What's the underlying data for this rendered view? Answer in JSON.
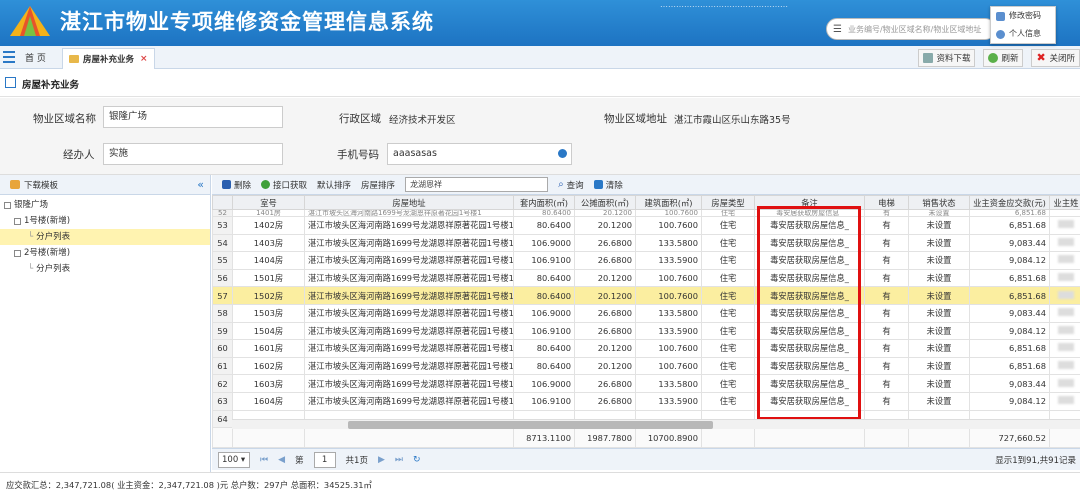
{
  "app": {
    "title": "湛江市物业专项维修资金管理信息系统",
    "top_right_text": "…………………………………………",
    "search_placeholder": "业务编号/物业区域名称/物业区域地址",
    "user_menu": [
      "修改密码",
      "个人信息"
    ],
    "colors": {
      "header": "#1d73c2",
      "selected_row": "#fbeea0",
      "tree_selected": "#fff3b0",
      "highlight": "#e01010"
    }
  },
  "menu_bar": {
    "home_tab": "首 页",
    "active_tab": "房屋补充业务",
    "close_icon": "×",
    "right_buttons": [
      "资料下载",
      "刷新",
      "关闭所"
    ]
  },
  "page_title": "房屋补充业务",
  "form": {
    "region_label": "物业区域名称",
    "region_value": "银隆广场",
    "district_label": "行政区域",
    "district_value": "经济技术开发区",
    "address_label": "物业区域地址",
    "address_value": "湛江市霞山区乐山东路35号",
    "handler_label": "经办人",
    "handler_value": "实施",
    "phone_label": "手机号码",
    "phone_value": "aaasasas"
  },
  "sidebar": {
    "header": "下载模板",
    "collapse_icon": "«",
    "tree": [
      {
        "label": "银隆广场",
        "level": 0,
        "selected": false
      },
      {
        "label": "1号楼(新增)",
        "level": 1,
        "selected": false
      },
      {
        "label": "分户列表",
        "level": 2,
        "selected": true
      },
      {
        "label": "2号楼(新增)",
        "level": 1,
        "selected": false
      },
      {
        "label": "分户列表",
        "level": 2,
        "selected": false
      }
    ]
  },
  "grid_toolbar": {
    "delete": "删除",
    "api_fetch": "接口获取",
    "default_sort": "默认排序",
    "house_sort": "房屋排序",
    "search_value": "龙湖恩祥",
    "query": "查询",
    "clear": "清除"
  },
  "table": {
    "columns": [
      "室号",
      "房屋地址",
      "套内面积(㎡)",
      "公摊面积(㎡)",
      "建筑面积(㎡)",
      "房屋类型",
      "备注",
      "电梯",
      "销售状态",
      "业主资金应交款(元)",
      "业主姓"
    ],
    "cut_row": {
      "num": "52",
      "room": "1401房",
      "address": "湛江市坡头区海河南路1699号龙湖恩祥原著花园1号楼1",
      "inner": "80.6400",
      "shared": "20.1200",
      "built": "100.7600",
      "type": "住宅",
      "note": "毒安居获取房屋信息_",
      "elevator": "有",
      "status": "未设置",
      "amount": "6,851.68"
    },
    "rows": [
      {
        "num": "53",
        "room": "1402房",
        "address": "湛江市坡头区海河南路1699号龙湖恩祥原著花园1号楼1",
        "inner": "80.6400",
        "shared": "20.1200",
        "built": "100.7600",
        "type": "住宅",
        "note": "毒安居获取房屋信息_",
        "elevator": "有",
        "status": "未设置",
        "amount": "6,851.68",
        "selected": false
      },
      {
        "num": "54",
        "room": "1403房",
        "address": "湛江市坡头区海河南路1699号龙湖恩祥原著花园1号楼1",
        "inner": "106.9000",
        "shared": "26.6800",
        "built": "133.5800",
        "type": "住宅",
        "note": "毒安居获取房屋信息_",
        "elevator": "有",
        "status": "未设置",
        "amount": "9,083.44",
        "selected": false
      },
      {
        "num": "55",
        "room": "1404房",
        "address": "湛江市坡头区海河南路1699号龙湖恩祥原著花园1号楼1",
        "inner": "106.9100",
        "shared": "26.6800",
        "built": "133.5900",
        "type": "住宅",
        "note": "毒安居获取房屋信息_",
        "elevator": "有",
        "status": "未设置",
        "amount": "9,084.12",
        "selected": false
      },
      {
        "num": "56",
        "room": "1501房",
        "address": "湛江市坡头区海河南路1699号龙湖恩祥原著花园1号楼1",
        "inner": "80.6400",
        "shared": "20.1200",
        "built": "100.7600",
        "type": "住宅",
        "note": "毒安居获取房屋信息_",
        "elevator": "有",
        "status": "未设置",
        "amount": "6,851.68",
        "selected": false
      },
      {
        "num": "57",
        "room": "1502房",
        "address": "湛江市坡头区海河南路1699号龙湖恩祥原著花园1号楼1",
        "inner": "80.6400",
        "shared": "20.1200",
        "built": "100.7600",
        "type": "住宅",
        "note": "毒安居获取房屋信息_",
        "elevator": "有",
        "status": "未设置",
        "amount": "6,851.68",
        "selected": true
      },
      {
        "num": "58",
        "room": "1503房",
        "address": "湛江市坡头区海河南路1699号龙湖恩祥原著花园1号楼1",
        "inner": "106.9000",
        "shared": "26.6800",
        "built": "133.5800",
        "type": "住宅",
        "note": "毒安居获取房屋信息_",
        "elevator": "有",
        "status": "未设置",
        "amount": "9,083.44",
        "selected": false
      },
      {
        "num": "59",
        "room": "1504房",
        "address": "湛江市坡头区海河南路1699号龙湖恩祥原著花园1号楼1",
        "inner": "106.9100",
        "shared": "26.6800",
        "built": "133.5900",
        "type": "住宅",
        "note": "毒安居获取房屋信息_",
        "elevator": "有",
        "status": "未设置",
        "amount": "9,084.12",
        "selected": false
      },
      {
        "num": "60",
        "room": "1601房",
        "address": "湛江市坡头区海河南路1699号龙湖恩祥原著花园1号楼1",
        "inner": "80.6400",
        "shared": "20.1200",
        "built": "100.7600",
        "type": "住宅",
        "note": "毒安居获取房屋信息_",
        "elevator": "有",
        "status": "未设置",
        "amount": "6,851.68",
        "selected": false
      },
      {
        "num": "61",
        "room": "1602房",
        "address": "湛江市坡头区海河南路1699号龙湖恩祥原著花园1号楼1",
        "inner": "80.6400",
        "shared": "20.1200",
        "built": "100.7600",
        "type": "住宅",
        "note": "毒安居获取房屋信息_",
        "elevator": "有",
        "status": "未设置",
        "amount": "6,851.68",
        "selected": false
      },
      {
        "num": "62",
        "room": "1603房",
        "address": "湛江市坡头区海河南路1699号龙湖恩祥原著花园1号楼1",
        "inner": "106.9000",
        "shared": "26.6800",
        "built": "133.5800",
        "type": "住宅",
        "note": "毒安居获取房屋信息_",
        "elevator": "有",
        "status": "未设置",
        "amount": "9,083.44",
        "selected": false
      },
      {
        "num": "63",
        "room": "1604房",
        "address": "湛江市坡头区海河南路1699号龙湖恩祥原著花园1号楼1",
        "inner": "106.9100",
        "shared": "26.6800",
        "built": "133.5900",
        "type": "住宅",
        "note": "毒安居获取房屋信息_",
        "elevator": "有",
        "status": "未设置",
        "amount": "9,084.12",
        "selected": false
      }
    ],
    "empty_row_num": "64",
    "totals": {
      "inner": "8713.1100",
      "shared": "1987.7800",
      "built": "10700.8900",
      "amount": "727,660.52"
    }
  },
  "pager": {
    "page_size": "100",
    "page_label": "第",
    "page_value": "1",
    "total_pages": "共1页",
    "info": "显示1到91,共91记录"
  },
  "footer": {
    "text": "应交款汇总：2,347,721.08( 业主资金：2,347,721.08 )元   总户数：297户   总面积：34525.31㎡"
  }
}
